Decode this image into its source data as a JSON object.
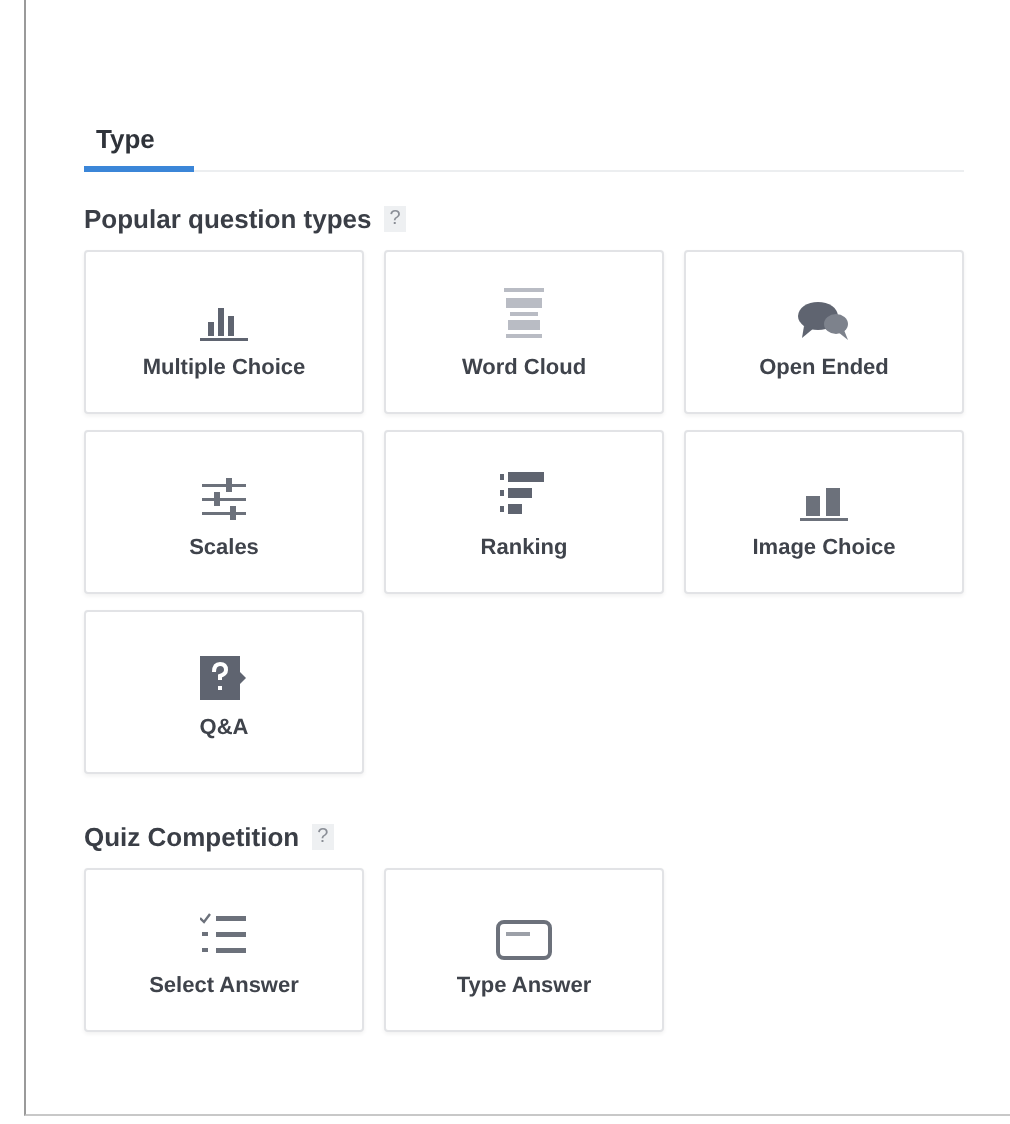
{
  "tabs": [
    {
      "label": "Type",
      "selected": true
    }
  ],
  "sections": [
    {
      "heading": "Popular question types",
      "help": "?",
      "items": [
        {
          "kind": "bars",
          "label": "Multiple Choice"
        },
        {
          "kind": "cloud",
          "label": "Word Cloud"
        },
        {
          "kind": "bubbles",
          "label": "Open Ended"
        },
        {
          "kind": "sliders",
          "label": "Scales"
        },
        {
          "kind": "ranking",
          "label": "Ranking"
        },
        {
          "kind": "images",
          "label": "Image Choice"
        },
        {
          "kind": "question",
          "label": "Q&A"
        }
      ]
    },
    {
      "heading": "Quiz Competition",
      "help": "?",
      "items": [
        {
          "kind": "checklist",
          "label": "Select Answer"
        },
        {
          "kind": "textbox",
          "label": "Type Answer"
        }
      ]
    }
  ]
}
